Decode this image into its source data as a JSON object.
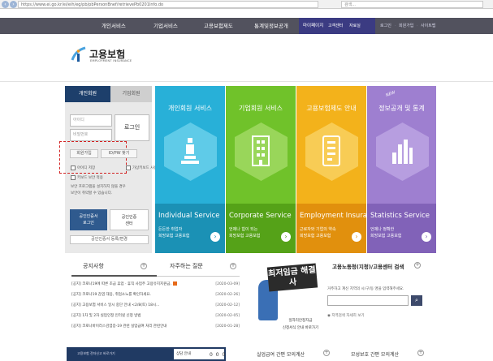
{
  "browser": {
    "url": "https://www.ei.go.kr/ei/eih/eg/pb/pbPersonBnef/retrievePb0201Info.do",
    "search_placeholder": "검색..."
  },
  "top_nav": {
    "items": [
      "개인서비스",
      "기업서비스",
      "고용보험제도",
      "통계및정보공개"
    ],
    "mypage": "마이페이지",
    "support": "고객센터",
    "data_room": "자료실",
    "login": "로그인",
    "membership": "회원가입",
    "sitemap": "사이트맵"
  },
  "logo": {
    "name": "고용보험",
    "sub": "EMPLOYMENT INSURANCE"
  },
  "login": {
    "tab_personal": "개인회원",
    "tab_corporate": "기업회원",
    "id_placeholder": "아이디",
    "pw_placeholder": "비밀번호",
    "login_button": "로그인",
    "join_button": "회원가입",
    "find_button": "ID/PW 찾기",
    "save_id": "아이디 저장",
    "keyboard": "가상키보드 사용",
    "security": "키보드 보안 적용",
    "notice_line1": "보안 프로그램을 설치하지 않을 경우",
    "notice_line2": "보안이 취약할 수 있습니다.",
    "cert_login_1": "공인인증서",
    "cert_login_2": "로그인",
    "cert_manage_1": "공인인증",
    "cert_manage_2": "센터",
    "cert_register": "공인인증서 등록/변경"
  },
  "tiles": [
    {
      "title": "개인회원 서비스",
      "english": "Individual Service",
      "desc_1": "든든한 취업자",
      "desc_2": "희망보험 고용보험"
    },
    {
      "title": "기업회원 서비스",
      "english": "Corporate Service",
      "desc_1": "언제나 힘이 되는",
      "desc_2": "희망보험 고용보험"
    },
    {
      "title": "고용보험제도 안내",
      "english": "Employment Insurance",
      "desc_1": "근로자와 기업의 약속",
      "desc_2": "희망보험 고용보험"
    },
    {
      "title": "정보공개 및 통계",
      "english": "Statistics Service",
      "desc_1": "언제나 정확한",
      "desc_2": "희망보험 고용보험"
    }
  ],
  "tile_badge": "NEW",
  "notices": {
    "tab_notice": "공지사항",
    "tab_faq": "자주하는 질문",
    "items": [
      {
        "text": "[공지] 코로나19에 따른 조금 휴업 · 휴직 사업주 고용유지지원금,",
        "date": "[2020-03-09]"
      },
      {
        "text": "[공지] 코로나19 감염 대응, 취업소노를 확인하세요.",
        "date": "[2020-02-26]"
      },
      {
        "text": "[공지] 고용보험 서비스 일시 중단 안내 <2/8(토) 18시...",
        "date": "[2020-02-12]"
      },
      {
        "text": "[공지] 1차 및 2차 실업인정 인터넷 신청 방법",
        "date": "[2020-02-05]"
      },
      {
        "text": "[공지] 코로나바이러스감염증-19 관련 실업급여 처리 관련안내",
        "date": "[2020-01-28]"
      }
    ]
  },
  "min_wage": {
    "title": "최저임금 해결사",
    "line1": "일자리안정자금",
    "line2": "신청서식 안내 바로가기"
  },
  "office_search": {
    "title": "고용노동청(지청)/고용센터 검색",
    "desc": "거주하고 계신 지역의 시/구/동 명을 입력해주세요.",
    "map_link": "지역검색 자세히 보기",
    "go": "🔍"
  },
  "bottom": {
    "dark_text": "고용보험 전자신고 바로가기",
    "dark_label": "상담 안내",
    "dark_num": "0 0 0",
    "calc1": "실업급여 간편 모의계산",
    "calc2": "모성보호 간편 모의계산"
  }
}
